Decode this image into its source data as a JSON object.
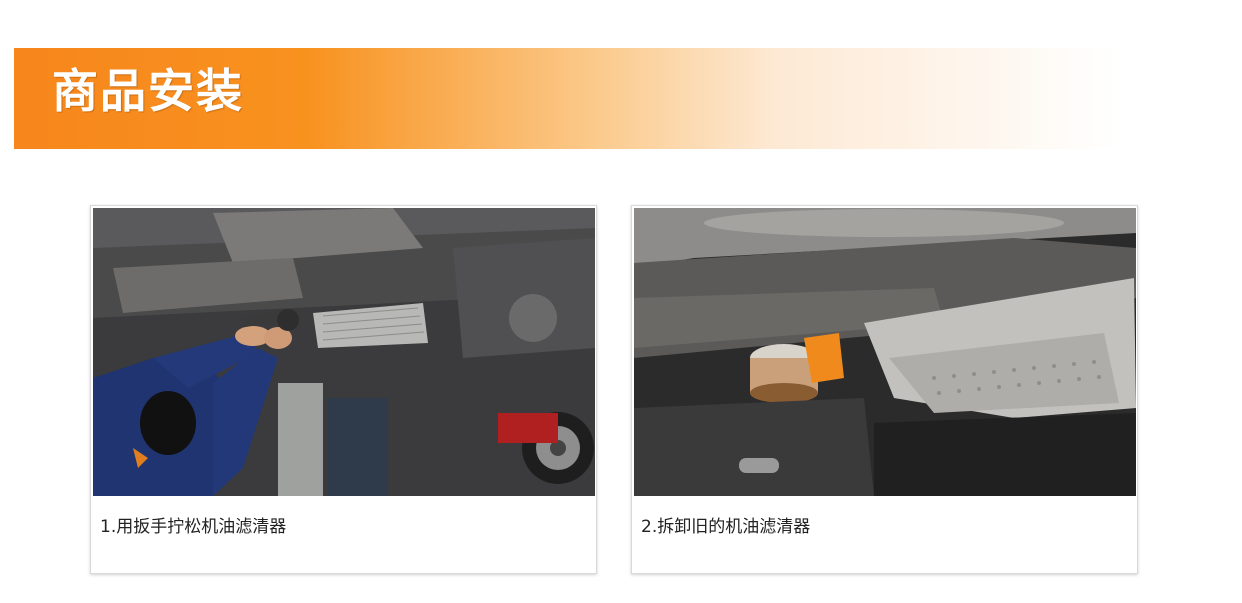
{
  "banner": {
    "title": "商品安装"
  },
  "steps": [
    {
      "caption": "1.用扳手拧松机油滤清器",
      "photo": "photo-mechanic-loosening-oil-filter"
    },
    {
      "caption": "2.拆卸旧的机油滤清器",
      "photo": "photo-removed-oil-filter-undercarriage"
    }
  ],
  "colors": {
    "banner_orange": "#f7861c",
    "caption_text": "#222222"
  }
}
